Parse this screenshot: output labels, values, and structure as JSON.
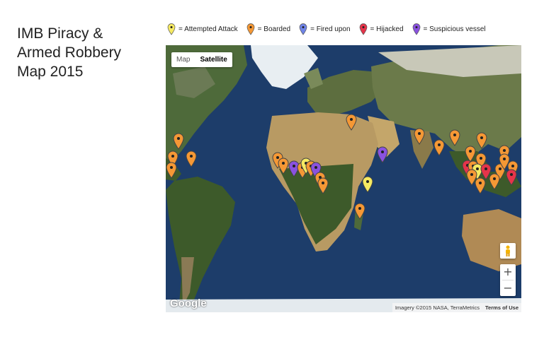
{
  "title": {
    "line1": "IMB Piracy &",
    "line2": "Armed Robbery",
    "line3": "Map 2015"
  },
  "legend": [
    {
      "label": "= Attempted Attack",
      "color": "#f6ea62",
      "icon": "yellow-marker-icon"
    },
    {
      "label": "= Boarded",
      "color": "#f59835",
      "icon": "orange-marker-icon"
    },
    {
      "label": "= Fired upon",
      "color": "#6f84e8",
      "icon": "blue-marker-icon"
    },
    {
      "label": "= Hijacked",
      "color": "#e6344a",
      "icon": "red-marker-icon"
    },
    {
      "label": "= Suspicious vessel",
      "color": "#8a52e0",
      "icon": "purple-marker-icon"
    }
  ],
  "map": {
    "type_buttons": {
      "map": "Map",
      "satellite": "Satellite",
      "selected": "Satellite"
    },
    "zoom_in": "+",
    "zoom_out": "−",
    "logo": "Google",
    "attribution": "Imagery ©2015 NASA, TerraMetrics",
    "terms": "Terms of Use",
    "ocean_color": "#1d3d6a",
    "land_colors": {
      "forest": "#3d5a2a",
      "desert": "#b89a63",
      "ice": "#e8eef2"
    }
  }
}
